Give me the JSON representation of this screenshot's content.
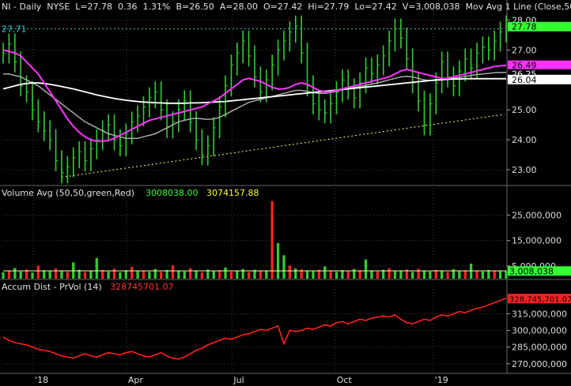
{
  "header": {
    "symbol": "NI",
    "period": "Daily",
    "exchange": "NYSE",
    "last": "L=27.78",
    "change": "0.36",
    "change_pct": "1.31%",
    "bid": "B=26.50",
    "ask": "A=28.00",
    "open": "O=27.42",
    "high": "Hi=27.79",
    "low": "Lo=27.42",
    "volume": "V=3,008,038",
    "study": "Mov Avg 1 Line (Close,50, ..."
  },
  "volume_header": {
    "label": "Volume Avg (50,50,green,Red)",
    "vol_value": "3008038.00",
    "avg_value": "3074157.88"
  },
  "ad_header": {
    "label": "Accum Dist - PrVol (14)",
    "value": "328745701.07"
  },
  "colors": {
    "background": "#000000",
    "up_bar": "#33cc33",
    "down_bar": "#ff2222",
    "ma_50": "#ff33ff",
    "ma_200": "#ffffff",
    "ma_100": "#aaaaaa",
    "trendline": "#ffff66",
    "dotted_level": "#33cccc",
    "accum_dist": "#ff2222",
    "grid": "#404040"
  },
  "chart_data": [
    {
      "type": "line",
      "name": "price",
      "x_ticks": [
        "'18",
        "Apr",
        "Jul",
        "Oct",
        "'19"
      ],
      "y_ticks": [
        "28.00",
        "27.00",
        "26.00",
        "25.00",
        "24.00",
        "23.00"
      ],
      "ylim": [
        22.5,
        28.3
      ],
      "grid": true,
      "price_labels": [
        {
          "text": "27.78",
          "value": 27.78,
          "bg": "#33ff33",
          "fg": "#000000"
        },
        {
          "text": "26.49",
          "value": 26.49,
          "bg": "#ff33ff",
          "fg": "#000000"
        },
        {
          "text": "26.25",
          "value": 26.25,
          "bg": "#000000",
          "fg": "#ffffff"
        },
        {
          "text": "26.04",
          "value": 26.04,
          "bg": "#ffffff",
          "fg": "#000000"
        }
      ],
      "left_label": {
        "text": "27.71",
        "value": 27.71
      },
      "close_series": [
        26.9,
        27.2,
        26.6,
        25.8,
        25.6,
        25.0,
        24.6,
        24.3,
        24.0,
        23.3,
        22.9,
        23.1,
        23.4,
        23.6,
        23.3,
        23.7,
        24.0,
        24.3,
        24.5,
        24.0,
        23.8,
        24.2,
        24.6,
        24.8,
        25.1,
        25.4,
        25.6,
        25.0,
        24.4,
        24.6,
        25.0,
        25.3,
        24.6,
        24.0,
        23.5,
        23.8,
        24.4,
        25.1,
        25.8,
        26.5,
        26.9,
        27.3,
        26.8,
        26.1,
        25.6,
        26.0,
        26.5,
        27.0,
        27.3,
        27.6,
        27.8,
        26.9,
        25.8,
        25.2,
        25.0,
        24.9,
        25.2,
        25.6,
        26.0,
        25.7,
        25.4,
        25.9,
        26.4,
        26.2,
        26.5,
        26.8,
        27.3,
        27.7,
        27.4,
        26.7,
        25.9,
        25.3,
        24.5,
        25.2,
        25.9,
        26.6,
        26.1,
        25.8,
        26.3,
        26.7,
        26.4,
        26.9,
        27.1,
        27.0,
        27.3,
        27.6,
        27.8
      ],
      "ma_50": [
        27.0,
        26.95,
        26.9,
        26.8,
        26.6,
        26.4,
        26.2,
        25.9,
        25.6,
        25.3,
        25.0,
        24.7,
        24.45,
        24.25,
        24.1,
        24.0,
        23.95,
        23.95,
        23.98,
        24.05,
        24.15,
        24.25,
        24.35,
        24.45,
        24.55,
        24.65,
        24.7,
        24.75,
        24.8,
        24.85,
        24.9,
        24.95,
        25.0,
        25.05,
        25.1,
        25.2,
        25.3,
        25.4,
        25.55,
        25.7,
        25.85,
        26.0,
        26.05,
        26.0,
        25.95,
        25.85,
        25.75,
        25.7,
        25.7,
        25.75,
        25.85,
        25.9,
        25.85,
        25.75,
        25.65,
        25.6,
        25.6,
        25.65,
        25.7,
        25.75,
        25.8,
        25.85,
        25.9,
        25.95,
        26.0,
        26.05,
        26.1,
        26.2,
        26.3,
        26.35,
        26.3,
        26.25,
        26.2,
        26.15,
        26.1,
        26.05,
        26.05,
        26.1,
        26.15,
        26.2,
        26.25,
        26.3,
        26.35,
        26.4,
        26.45,
        26.47,
        26.49
      ],
      "ma_200": [
        25.7,
        25.75,
        25.8,
        25.85,
        25.88,
        25.9,
        25.9,
        25.88,
        25.85,
        25.82,
        25.78,
        25.74,
        25.7,
        25.65,
        25.6,
        25.55,
        25.5,
        25.46,
        25.42,
        25.38,
        25.35,
        25.32,
        25.3,
        25.28,
        25.26,
        25.25,
        25.24,
        25.23,
        25.22,
        25.22,
        25.22,
        25.22,
        25.23,
        25.23,
        25.24,
        25.25,
        25.26,
        25.27,
        25.28,
        25.3,
        25.32,
        25.34,
        25.36,
        25.38,
        25.4,
        25.42,
        25.44,
        25.46,
        25.48,
        25.5,
        25.52,
        25.54,
        25.56,
        25.58,
        25.6,
        25.62,
        25.64,
        25.66,
        25.68,
        25.7,
        25.72,
        25.74,
        25.76,
        25.78,
        25.8,
        25.82,
        25.84,
        25.86,
        25.88,
        25.9,
        25.92,
        25.94,
        25.96,
        25.98,
        26.0,
        26.01,
        26.02,
        26.03,
        26.03,
        26.04,
        26.04,
        26.04,
        26.04,
        26.04,
        26.04,
        26.04,
        26.04
      ],
      "ma_100": [
        26.2,
        26.2,
        26.15,
        26.1,
        26.0,
        25.9,
        25.8,
        25.65,
        25.5,
        25.35,
        25.2,
        25.05,
        24.9,
        24.75,
        24.6,
        24.5,
        24.4,
        24.3,
        24.2,
        24.15,
        24.1,
        24.05,
        24.05,
        24.05,
        24.1,
        24.15,
        24.2,
        24.3,
        24.4,
        24.5,
        24.6,
        24.65,
        24.7,
        24.72,
        24.7,
        24.68,
        24.7,
        24.75,
        24.85,
        24.95,
        25.05,
        25.15,
        25.25,
        25.3,
        25.35,
        25.4,
        25.45,
        25.5,
        25.55,
        25.6,
        25.65,
        25.65,
        25.62,
        25.58,
        25.55,
        25.55,
        25.58,
        25.62,
        25.68,
        25.72,
        25.75,
        25.78,
        25.82,
        25.86,
        25.9,
        25.95,
        26.0,
        26.05,
        26.1,
        26.12,
        26.1,
        26.05,
        26.0,
        25.98,
        25.98,
        26.0,
        26.02,
        26.05,
        26.08,
        26.12,
        26.15,
        26.18,
        26.2,
        26.22,
        26.24,
        26.25,
        26.25
      ]
    },
    {
      "type": "bar",
      "name": "volume",
      "y_ticks": [
        "25,000,000",
        "15,000,000",
        "5,000,000"
      ],
      "ylim": [
        0,
        32000000
      ],
      "last_label": "3,008,038",
      "values_millions": [
        2.5,
        3.1,
        4.2,
        2.8,
        3.6,
        2.4,
        5.1,
        3.3,
        2.9,
        4.0,
        3.2,
        2.7,
        6.4,
        3.5,
        2.6,
        3.0,
        8.1,
        3.4,
        2.8,
        3.9,
        2.5,
        3.3,
        4.6,
        2.9,
        3.1,
        2.7,
        3.8,
        2.6,
        3.4,
        5.2,
        3.0,
        2.8,
        4.1,
        3.2,
        2.5,
        3.6,
        2.9,
        3.3,
        4.4,
        2.7,
        3.1,
        3.8,
        2.6,
        3.5,
        2.9,
        3.2,
        30.5,
        14.0,
        9.2,
        5.1,
        4.0,
        3.6,
        3.2,
        2.9,
        3.5,
        4.8,
        3.1,
        2.7,
        3.4,
        2.9,
        3.8,
        3.3,
        7.6,
        3.0,
        2.8,
        3.5,
        4.1,
        2.9,
        3.2,
        3.6,
        2.7,
        3.9,
        3.1,
        2.8,
        3.4,
        3.0,
        2.6,
        3.7,
        2.9,
        3.3,
        5.9,
        3.1,
        2.8,
        3.4,
        3.0,
        2.9,
        3.0
      ],
      "up_flags": [
        1,
        0,
        1,
        1,
        0,
        1,
        0,
        1,
        1,
        0,
        1,
        0,
        1,
        1,
        0,
        1,
        1,
        0,
        1,
        0,
        1,
        1,
        0,
        1,
        0,
        1,
        1,
        0,
        1,
        0,
        1,
        1,
        0,
        1,
        0,
        1,
        1,
        0,
        1,
        0,
        1,
        1,
        0,
        1,
        0,
        1,
        0,
        1,
        1,
        0,
        1,
        0,
        1,
        1,
        0,
        1,
        0,
        1,
        1,
        0,
        1,
        0,
        1,
        1,
        0,
        1,
        0,
        1,
        1,
        0,
        1,
        0,
        1,
        1,
        0,
        1,
        0,
        1,
        1,
        0,
        1,
        0,
        1,
        1,
        0,
        1,
        1
      ],
      "avg_millions": 3.07
    },
    {
      "type": "line",
      "name": "accum_dist",
      "y_ticks": [
        "315,000,000",
        "300,000,000",
        "285,000,000",
        "270,000,000"
      ],
      "ylim": [
        262000000,
        336000000
      ],
      "last_label": "328,745,701.07",
      "values_millions": [
        294,
        291,
        289,
        288,
        287,
        285,
        283,
        282,
        281,
        279,
        277,
        276,
        275,
        277,
        279,
        277,
        276,
        278,
        280,
        279,
        278,
        280,
        281,
        279,
        277,
        276,
        278,
        280,
        277,
        275,
        274,
        276,
        279,
        282,
        284,
        287,
        289,
        291,
        293,
        292,
        294,
        296,
        297,
        299,
        301,
        300,
        302,
        304,
        288,
        300,
        299,
        300,
        302,
        301,
        303,
        305,
        304,
        307,
        308,
        306,
        308,
        310,
        309,
        311,
        312,
        313,
        312,
        314,
        310,
        307,
        306,
        308,
        310,
        309,
        312,
        314,
        313,
        315,
        317,
        316,
        318,
        320,
        321,
        323,
        325,
        327,
        329
      ]
    }
  ]
}
